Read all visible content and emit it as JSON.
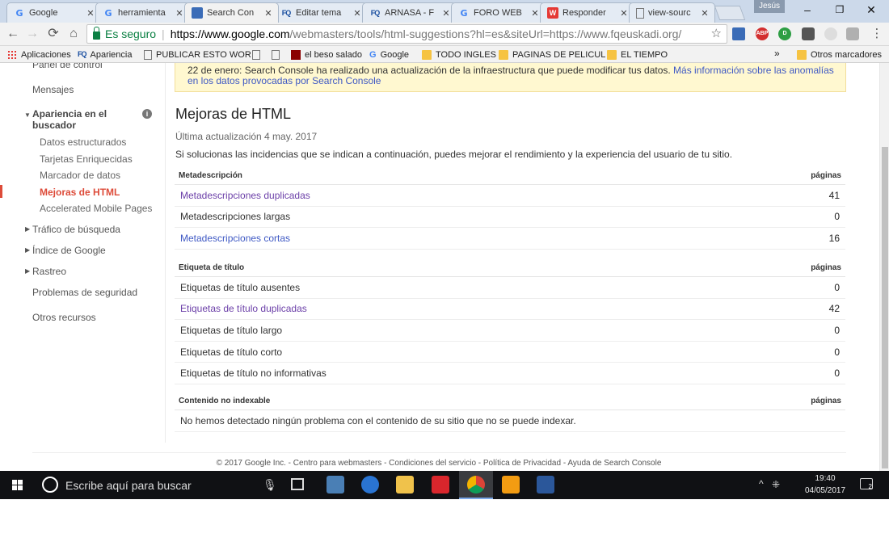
{
  "tabs": [
    {
      "label": "Google",
      "icon": "google-icon"
    },
    {
      "label": "herramienta",
      "icon": "google-icon"
    },
    {
      "label": "Search Con",
      "icon": "webmasters-icon"
    },
    {
      "label": "Editar tema",
      "icon": "fq-icon"
    },
    {
      "label": "ARNASA - F",
      "icon": "fq-icon"
    },
    {
      "label": "FORO WEB",
      "icon": "google-icon"
    },
    {
      "label": "Responder",
      "icon": "w-icon"
    },
    {
      "label": "view-sourc",
      "icon": "page-icon"
    }
  ],
  "window": {
    "profile": "Jesús",
    "minimize": "–",
    "restore": "❐",
    "close": "✕"
  },
  "toolbar": {
    "back": "←",
    "forward": "→",
    "reload": "⟳",
    "home": "⌂",
    "secure_label": "Es seguro",
    "url_host": "https://www.google.com",
    "url_path": "/webmasters/tools/html-suggestions?hl=es&siteUrl=https://www.fqeuskadi.org/",
    "star": "☆",
    "menu": "⋮"
  },
  "bookmarks": {
    "items": [
      {
        "label": "Aplicaciones"
      },
      {
        "label": "Apariencia"
      },
      {
        "label": "PUBLICAR ESTO WOR"
      },
      {
        "label": ""
      },
      {
        "label": ""
      },
      {
        "label": "el beso salado"
      },
      {
        "label": "Google"
      },
      {
        "label": "TODO INGLES"
      },
      {
        "label": "PAGINAS DE PELICUL"
      },
      {
        "label": "EL TIEMPO"
      }
    ],
    "more": "»",
    "other": "Otros marcadores"
  },
  "sidebar": {
    "panel": "Panel de control",
    "mensajes": "Mensajes",
    "apariencia": "Apariencia en el buscador",
    "sub": [
      {
        "label": "Datos estructurados"
      },
      {
        "label": "Tarjetas Enriquecidas"
      },
      {
        "label": "Marcador de datos"
      },
      {
        "label": "Mejoras de HTML"
      },
      {
        "label": "Accelerated Mobile Pages"
      }
    ],
    "trafico": "Tráfico de búsqueda",
    "indice": "Índice de Google",
    "rastreo": "Rastreo",
    "seguridad": "Problemas de seguridad",
    "otros": "Otros recursos"
  },
  "notice": {
    "text": "22 de enero: Search Console ha realizado una actualización de la infraestructura que puede modificar tus datos. ",
    "link": "Más información sobre las anomalías en los datos provocadas por Search Console"
  },
  "main": {
    "title": "Mejoras de HTML",
    "updated": "Última actualización 4 may. 2017",
    "intro": "Si solucionas las incidencias que se indican a continuación, puedes mejorar el rendimiento y la experiencia del usuario de tu sitio.",
    "pages_label": "páginas",
    "meta": {
      "header": "Metadescripción",
      "rows": [
        {
          "label": "Metadescripciones duplicadas",
          "count": "41"
        },
        {
          "label": "Metadescripciones largas",
          "count": "0"
        },
        {
          "label": "Metadescripciones cortas",
          "count": "16"
        }
      ]
    },
    "titulo": {
      "header": "Etiqueta de título",
      "rows": [
        {
          "label": "Etiquetas de título ausentes",
          "count": "0"
        },
        {
          "label": "Etiquetas de título duplicadas",
          "count": "42"
        },
        {
          "label": "Etiquetas de título largo",
          "count": "0"
        },
        {
          "label": "Etiquetas de título corto",
          "count": "0"
        },
        {
          "label": "Etiquetas de título no informativas",
          "count": "0"
        }
      ]
    },
    "noindex": {
      "header": "Contenido no indexable",
      "message": "No hemos detectado ningún problema con el contenido de su sitio que no se puede indexar."
    }
  },
  "footer": "© 2017 Google Inc. - Centro para webmasters - Condiciones del servicio - Política de Privacidad - Ayuda de Search Console",
  "taskbar": {
    "search_placeholder": "Escribe aquí para buscar",
    "time": "19:40",
    "date": "04/05/2017",
    "notifications": "2"
  },
  "colors": {
    "accent": "#dd4b39",
    "link": "#3f59c4",
    "visited": "#6b3fa8",
    "notice_bg": "#fff8d0",
    "secure": "#0b8043"
  }
}
